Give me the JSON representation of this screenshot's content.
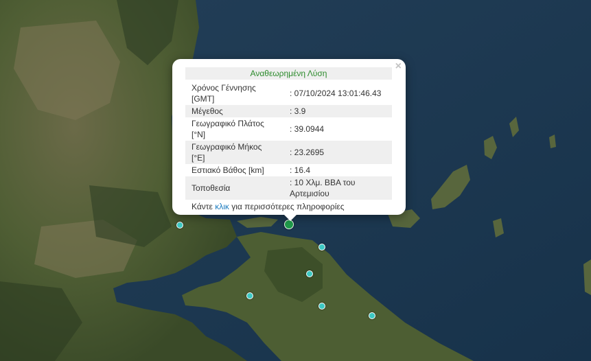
{
  "map": {
    "colors": {
      "sea": "#1c3a52",
      "land": "#4a5a32",
      "main_marker": "#1f9a4a",
      "marker": "#3ec9c4"
    },
    "markers": [
      {
        "type": "main-epicenter",
        "icon": "circle-marker-green"
      },
      {
        "type": "recent-event",
        "icon": "circle-marker-cyan"
      },
      {
        "type": "recent-event",
        "icon": "circle-marker-cyan"
      },
      {
        "type": "recent-event",
        "icon": "circle-marker-cyan"
      },
      {
        "type": "recent-event",
        "icon": "circle-marker-cyan"
      },
      {
        "type": "recent-event",
        "icon": "circle-marker-cyan"
      },
      {
        "type": "recent-event",
        "icon": "circle-marker-cyan"
      }
    ]
  },
  "popup": {
    "close_label": "×",
    "title": "Αναθεωρημένη Λύση",
    "rows": [
      {
        "label": "Χρόνος Γέννησης [GMT]",
        "value": ": 07/10/2024 13:01:46.43"
      },
      {
        "label": "Μέγεθος",
        "value": ": 3.9"
      },
      {
        "label": "Γεωγραφικό Πλάτος [°N]",
        "value": ": 39.0944"
      },
      {
        "label": "Γεωγραφικό Μήκος [°E]",
        "value": ": 23.2695"
      },
      {
        "label": "Εστιακό Βάθος [km]",
        "value": ": 16.4"
      },
      {
        "label": "Τοποθεσία",
        "value": ": 10 Χλμ. ΒΒΑ του Αρτεμισίου"
      }
    ],
    "more_prefix": "Κάντε ",
    "more_link": "κλικ",
    "more_suffix": " για περισσότερες πληροφορίες"
  }
}
